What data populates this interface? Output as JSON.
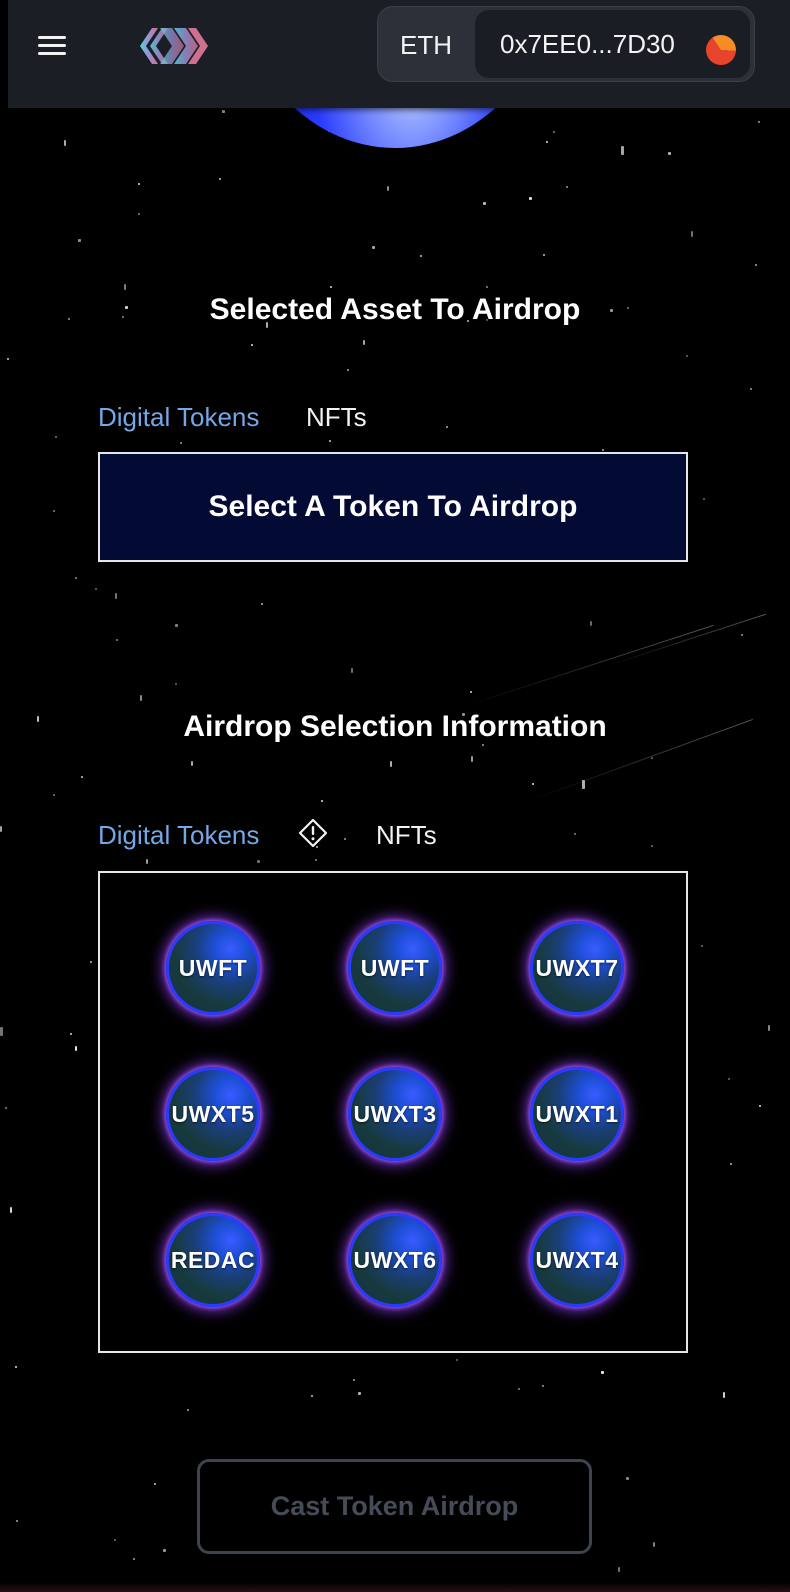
{
  "header": {
    "network_label": "ETH",
    "wallet_address": "0x7EE0...7D30"
  },
  "asset_section": {
    "title": "Selected Asset To Airdrop",
    "tabs": [
      {
        "label": "Digital Tokens",
        "active": true
      },
      {
        "label": "NFTs",
        "active": false
      }
    ],
    "select_button_label": "Select A Token To Airdrop"
  },
  "info_section": {
    "title": "Airdrop Selection Information",
    "tabs": [
      {
        "label": "Digital Tokens",
        "active": true
      },
      {
        "label": "NFTs",
        "active": false
      }
    ],
    "tokens": [
      "UWFT",
      "UWFT",
      "UWXT7",
      "UWXT5",
      "UWXT3",
      "UWXT1",
      "REDAC",
      "UWXT6",
      "UWXT4"
    ]
  },
  "cast_button_label": "Cast Token Airdrop",
  "colors": {
    "background": "#000000",
    "header": "#1b1e25",
    "active_tab": "#74a7e6",
    "select_box_fill": "#030a33",
    "token_ring": "#2a3bff",
    "token_glow": "#9a3cff",
    "disabled_button_text": "#454c58"
  },
  "icons": {
    "menu": "hamburger-menu-icon",
    "logo": "brand-logo",
    "avatar": "wallet-avatar-icon",
    "info": "diamond-info-icon"
  }
}
